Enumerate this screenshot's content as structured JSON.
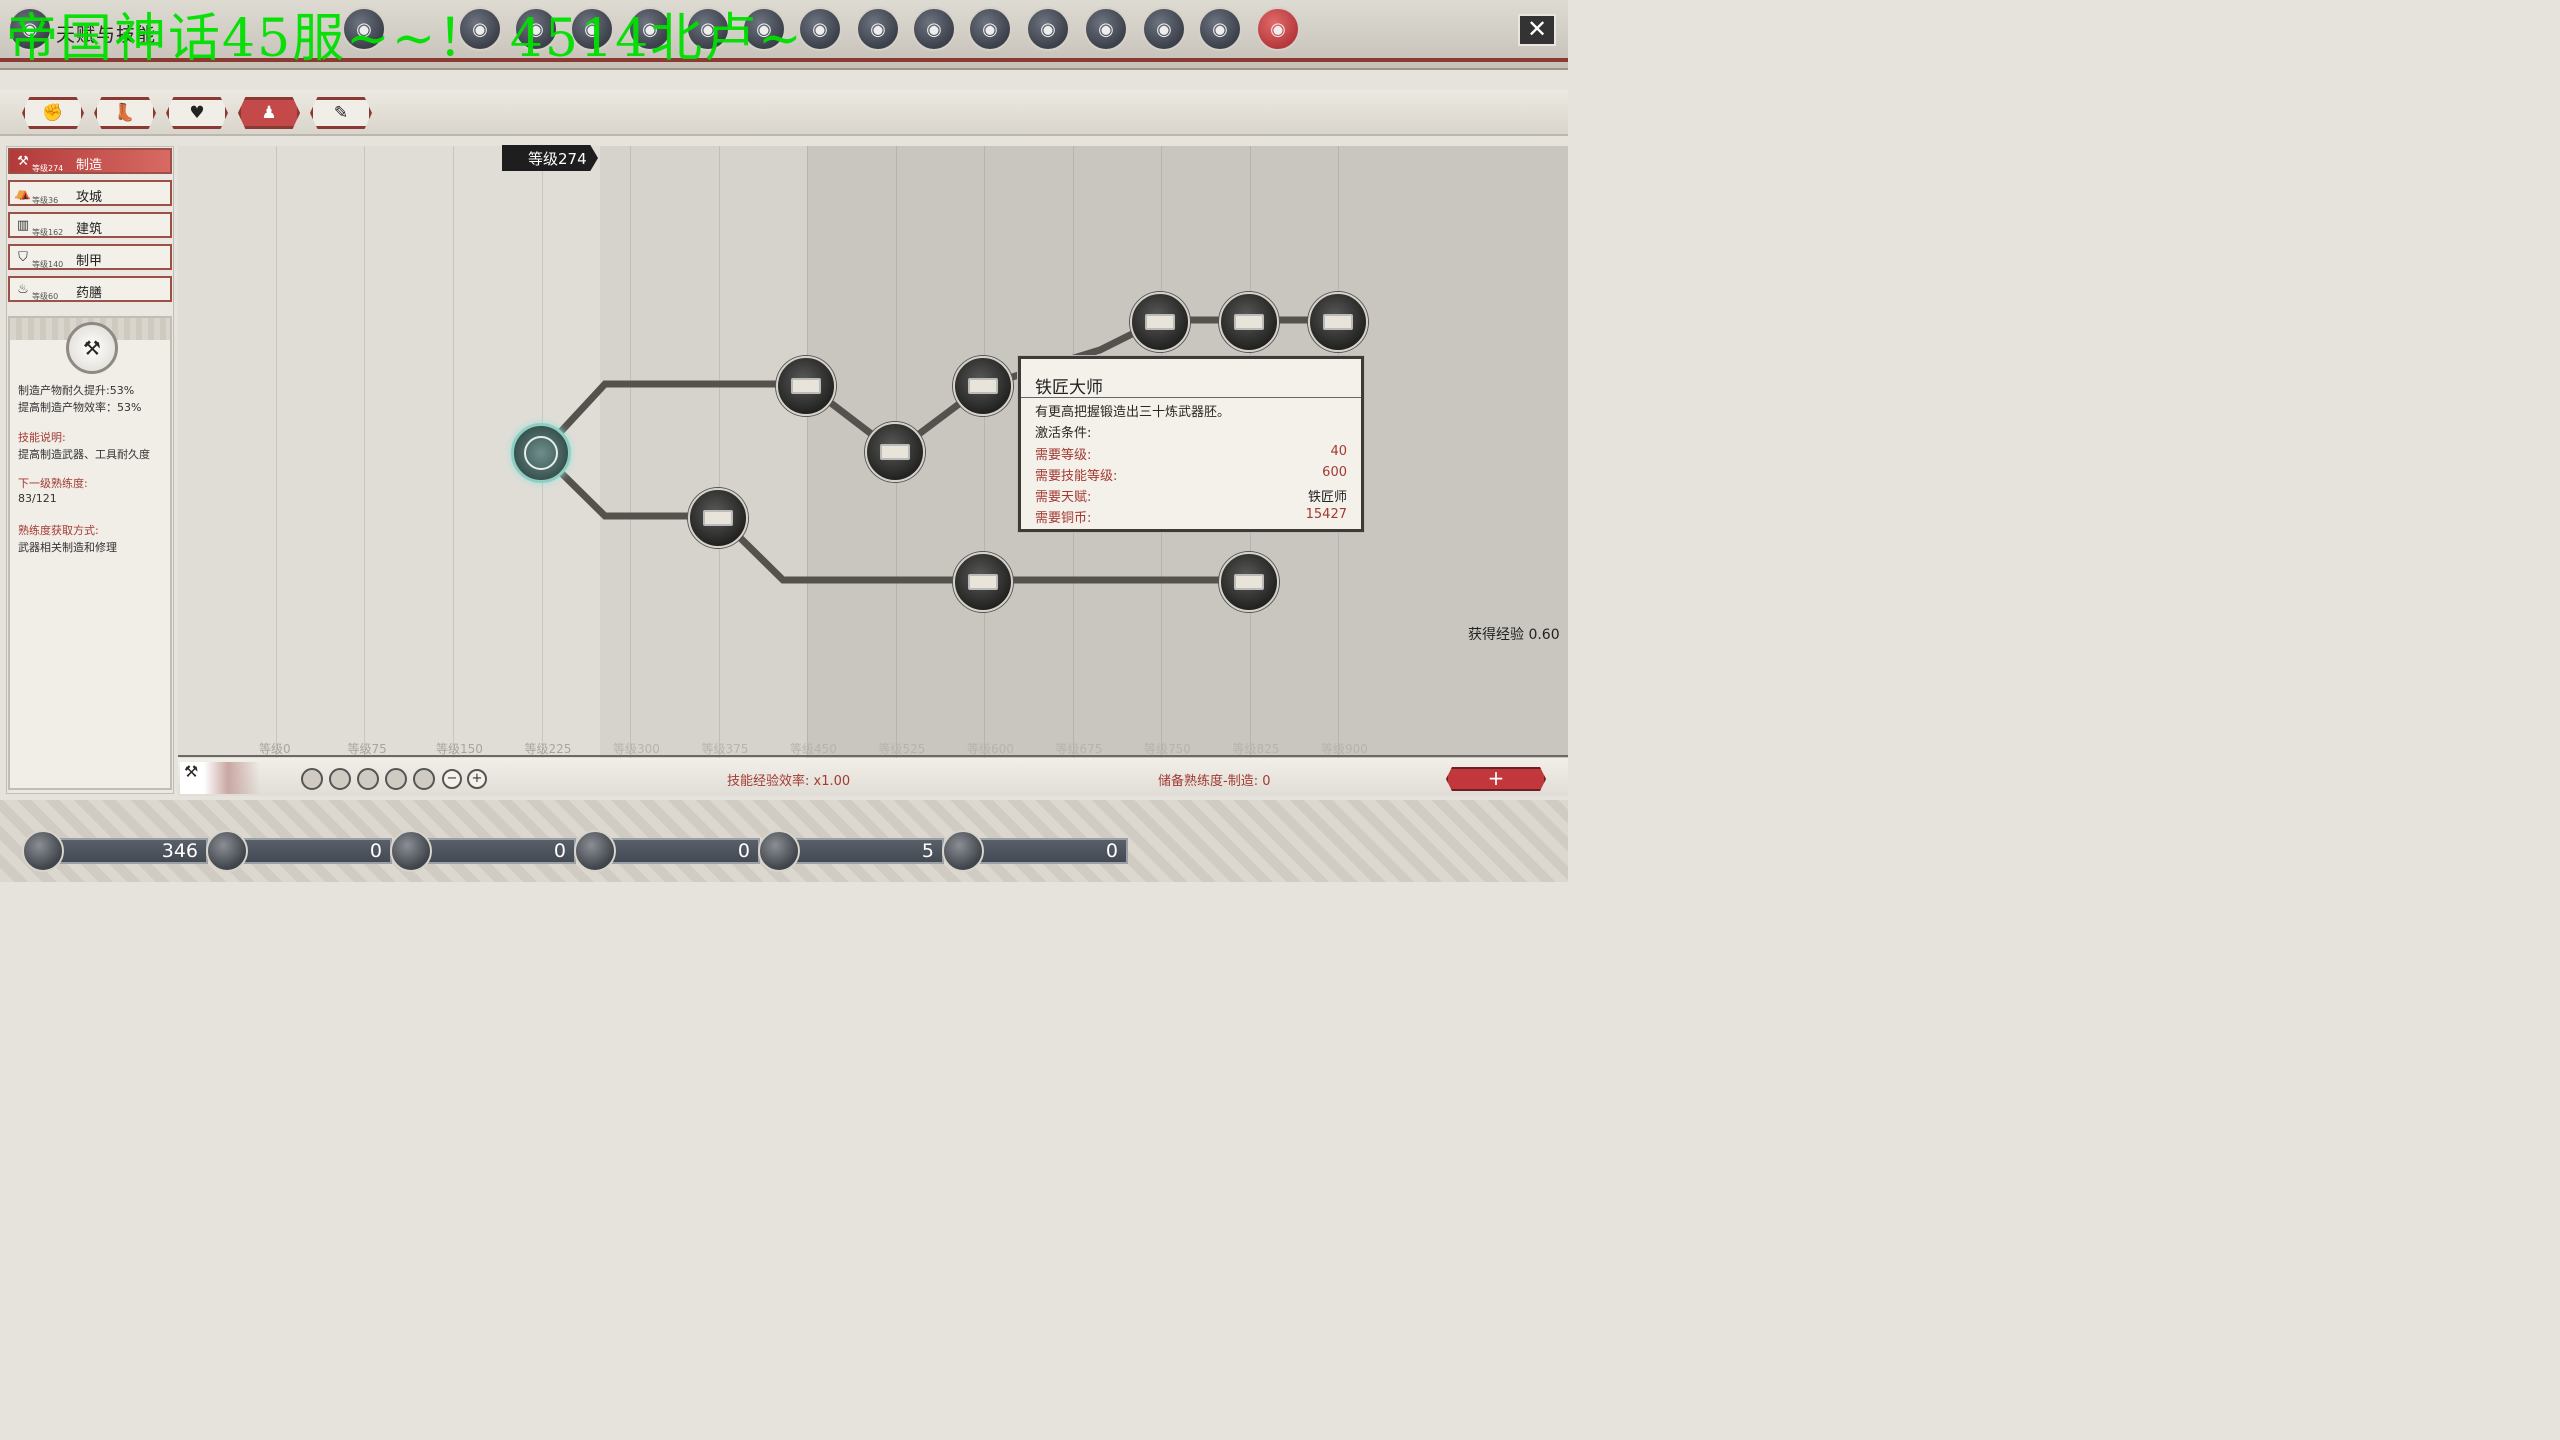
{
  "window": {
    "title": "天赋与技能",
    "watermark": "帝国神话45服~~！  4514北卢~",
    "close": "✕"
  },
  "top_icons": [
    "ornament-icon",
    "nav-icon-1",
    "nav-icon-2",
    "nav-icon-3",
    "nav-icon-4",
    "nav-icon-5",
    "nav-icon-6",
    "nav-icon-7",
    "nav-icon-8",
    "nav-icon-9",
    "nav-icon-10",
    "nav-icon-11",
    "nav-icon-12",
    "nav-icon-13",
    "nav-icon-14",
    "nav-icon-15",
    "skill-book-icon"
  ],
  "category_tabs": [
    {
      "icon": "✊",
      "name": "fist-icon"
    },
    {
      "icon": "👢",
      "name": "boot-icon"
    },
    {
      "icon": "♥",
      "name": "heart-icon"
    },
    {
      "icon": "♟",
      "name": "figure-icon"
    },
    {
      "icon": "✎",
      "name": "tool-icon"
    }
  ],
  "skills": [
    {
      "icon": "⚒",
      "level": "等级274",
      "name": "制造",
      "active": true
    },
    {
      "icon": "⛺",
      "level": "等级36",
      "name": "攻城"
    },
    {
      "icon": "▥",
      "level": "等级162",
      "name": "建筑"
    },
    {
      "icon": "⛉",
      "level": "等级140",
      "name": "制甲"
    },
    {
      "icon": "♨",
      "level": "等级60",
      "name": "药膳"
    }
  ],
  "detail": {
    "line1": "制造产物耐久提升:53%",
    "line2": "提高制造产物效率：53%",
    "desc_label": "技能说明:",
    "desc": "提高制造武器、工具耐久度",
    "next_label": "下一级熟练度:",
    "next_value": "83/121",
    "gain_label": "熟练度获取方式:",
    "gain_value": "武器相关制造和修理"
  },
  "tree": {
    "level_badge": "等级274",
    "exp_gain": "获得经验 0.60",
    "level_marks": [
      "等级0",
      "等级75",
      "等级150",
      "等级225",
      "等级300",
      "等级375",
      "等级450",
      "等级525",
      "等级600",
      "等级675",
      "等级750",
      "等级825",
      "等级900"
    ]
  },
  "tooltip": {
    "title": "铁匠大师",
    "desc": "有更高把握锻造出三十炼武器胚。",
    "cond_label": "激活条件:",
    "rows": [
      {
        "k": "需要等级:",
        "v": "40"
      },
      {
        "k": "需要技能等级:",
        "v": "600"
      },
      {
        "k": "需要天赋:",
        "v": "铁匠师"
      },
      {
        "k": "需要铜币:",
        "v": "15427"
      }
    ]
  },
  "bottom": {
    "efficiency": "技能经验效率: x1.00",
    "reserve": "储备熟练度-制造: 0",
    "minus": "−",
    "plus": "+",
    "add": "+"
  },
  "resources": [
    {
      "name": "coin-icon",
      "value": "346"
    },
    {
      "name": "scroll-icon",
      "value": "0"
    },
    {
      "name": "medal-icon",
      "value": "0"
    },
    {
      "name": "constellation-icon",
      "value": "0"
    },
    {
      "name": "refresh-icon",
      "value": "5"
    },
    {
      "name": "chest-icon",
      "value": "0"
    }
  ]
}
